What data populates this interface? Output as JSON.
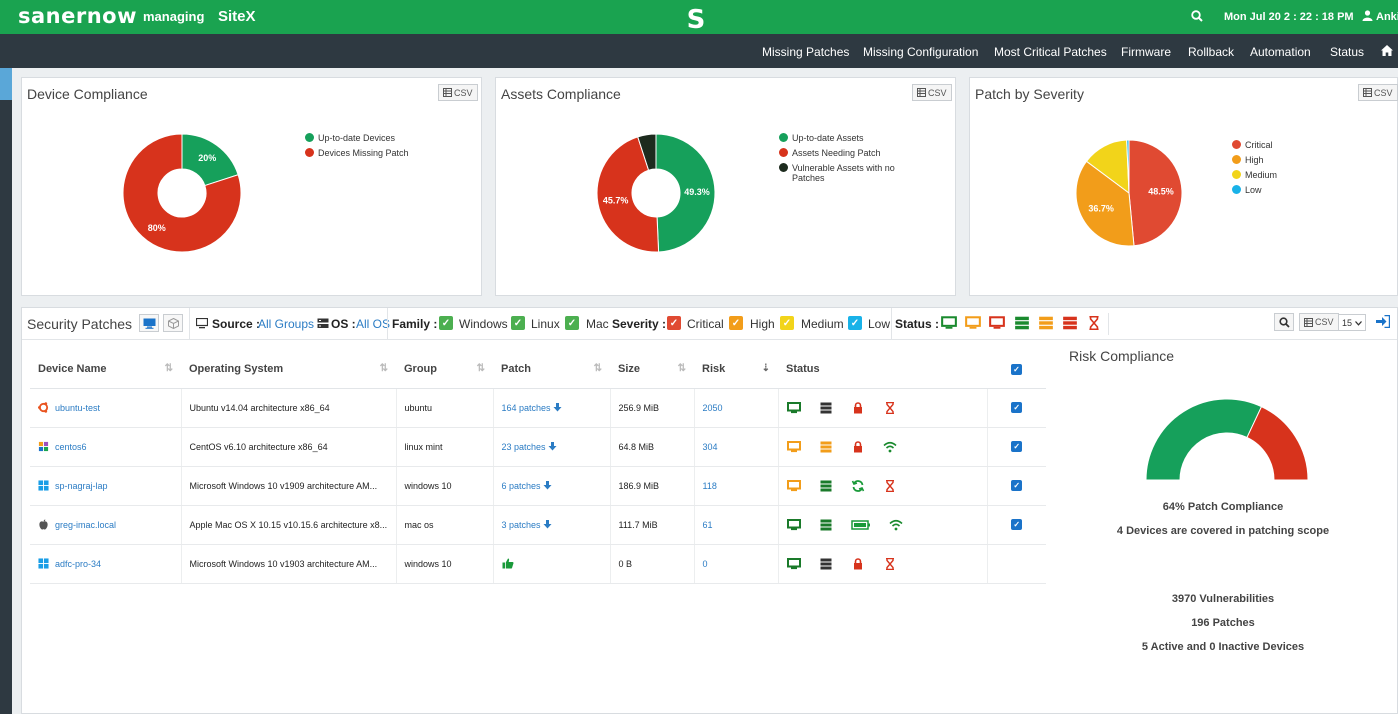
{
  "header": {
    "brand": "sanernow",
    "managing_label": "managing",
    "site": "SiteX",
    "logo_letter": "S",
    "datetime": "Mon Jul 20  2 : 22 : 18 PM",
    "user": "Ankit"
  },
  "nav": {
    "items": [
      "Missing Patches",
      "Missing Configuration",
      "Most Critical Patches",
      "Firmware",
      "Rollback",
      "Automation",
      "Status"
    ]
  },
  "device_compliance": {
    "title": "Device Compliance",
    "csv_label": "CSV",
    "legend": [
      "Up-to-date Devices",
      "Devices Missing Patch"
    ],
    "slices": [
      {
        "label": "Up-to-date Devices",
        "value": 20,
        "text": "20%",
        "color": "#16a05b"
      },
      {
        "label": "Devices Missing Patch",
        "value": 80,
        "text": "80%",
        "color": "#d7331c"
      }
    ]
  },
  "assets_compliance": {
    "title": "Assets Compliance",
    "csv_label": "CSV",
    "legend": [
      "Up-to-date Assets",
      "Assets Needing Patch",
      "Vulnerable Assets with no Patches"
    ],
    "slices": [
      {
        "label": "Up-to-date Assets",
        "value": 49.3,
        "text": "49.3%",
        "color": "#16a05b"
      },
      {
        "label": "Assets Needing Patch",
        "value": 45.7,
        "text": "45.7%",
        "color": "#d7331c"
      },
      {
        "label": "Vulnerable Assets with no Patches",
        "value": 5.0,
        "text": "",
        "color": "#1d2b1e"
      }
    ]
  },
  "patch_severity": {
    "title": "Patch by Severity",
    "csv_label": "CSV",
    "legend": [
      "Critical",
      "High",
      "Medium",
      "Low"
    ],
    "slices": [
      {
        "label": "Critical",
        "value": 48.5,
        "text": "48.5%",
        "color": "#e04a32"
      },
      {
        "label": "High",
        "value": 36.7,
        "text": "36.7%",
        "color": "#f29d1a"
      },
      {
        "label": "Medium",
        "value": 14.1,
        "text": "",
        "color": "#f2d41a"
      },
      {
        "label": "Low",
        "value": 0.7,
        "text": "",
        "color": "#19b2e8"
      }
    ]
  },
  "security_patches": {
    "title": "Security Patches",
    "source_label": "Source :",
    "source_value": "All Groups",
    "os_label": "OS :",
    "os_value": "All OS",
    "family_label": "Family :",
    "families": [
      "Windows",
      "Linux",
      "Mac"
    ],
    "severity_label": "Severity :",
    "severities": [
      "Critical",
      "High",
      "Medium",
      "Low"
    ],
    "status_label": "Status :",
    "csv_label": "CSV",
    "page_size": "15",
    "columns": [
      "Device Name",
      "Operating System",
      "Group",
      "Patch",
      "Size",
      "Risk",
      "Status"
    ],
    "rows": [
      {
        "device": "ubuntu-test",
        "os_icon": "ubuntu-icon",
        "os": "Ubuntu v14.04 architecture x86_64",
        "group": "ubuntu",
        "patch": "164 patches",
        "size": "256.9 MiB",
        "risk": "2050",
        "checked": true
      },
      {
        "device": "centos6",
        "os_icon": "centos-icon",
        "os": "CentOS v6.10 architecture x86_64",
        "group": "linux mint",
        "patch": "23 patches",
        "size": "64.8 MiB",
        "risk": "304",
        "checked": true
      },
      {
        "device": "sp-nagraj-lap",
        "os_icon": "windows-icon",
        "os": "Microsoft Windows 10 v1909 architecture AM...",
        "group": "windows 10",
        "patch": "6 patches",
        "size": "186.9 MiB",
        "risk": "118",
        "checked": true
      },
      {
        "device": "greg-imac.local",
        "os_icon": "apple-icon",
        "os": "Apple Mac OS X 10.15 v10.15.6 architecture x8...",
        "group": "mac os",
        "patch": "3 patches",
        "size": "111.7 MiB",
        "risk": "61",
        "checked": true
      },
      {
        "device": "adfc-pro-34",
        "os_icon": "windows-icon",
        "os": "Microsoft Windows 10 v1903 architecture AM...",
        "group": "windows 10",
        "patch": "",
        "size": "0 B",
        "risk": "0",
        "checked": false
      }
    ]
  },
  "risk_compliance": {
    "title": "Risk Compliance",
    "compliance_percent": 64,
    "compliance_text": "64% Patch Compliance",
    "scope_text": "4 Devices are covered in patching scope",
    "vulnerabilities_text": "3970 Vulnerabilities",
    "patches_text": "196 Patches",
    "devices_text": "5 Active and 0 Inactive Devices",
    "colors": {
      "good": "#16a05b",
      "bad": "#d7331c"
    }
  }
}
